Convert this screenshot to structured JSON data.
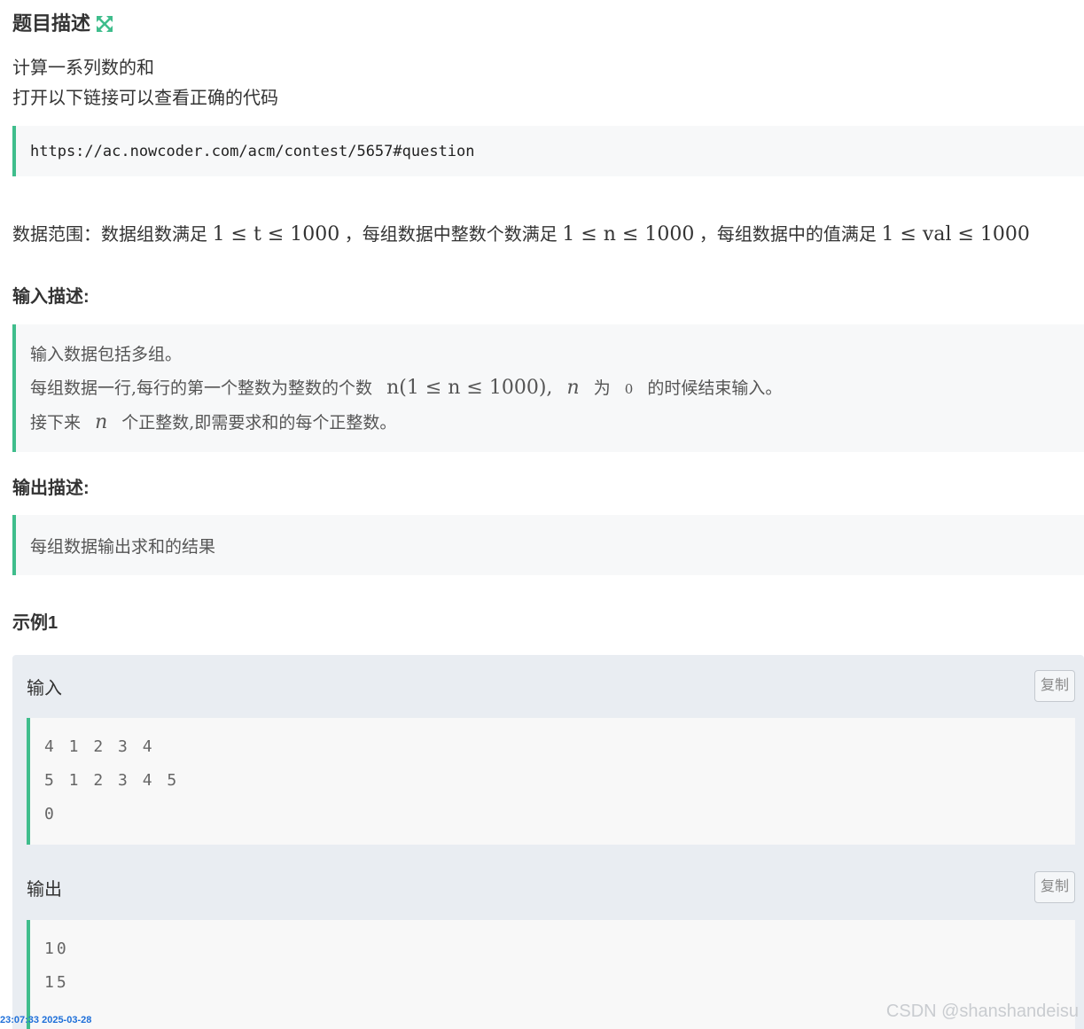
{
  "problem": {
    "title": "题目描述",
    "description_lines": [
      "计算一系列数的和",
      "打开以下链接可以查看正确的代码"
    ],
    "url": "https://ac.nowcoder.com/acm/contest/5657#question",
    "range": {
      "prefix": "数据范围：数据组数满足",
      "t_constraint": "1 ≤ t ≤ 1000",
      "mid1": "，每组数据中整数个数满足",
      "n_constraint": "1 ≤ n ≤ 1000",
      "mid2": "，每组数据中的值满足",
      "val_constraint": "1 ≤ val ≤ 1000"
    }
  },
  "input_desc": {
    "label": "输入描述:",
    "line1": "输入数据包括多组。",
    "line2_prefix": "每组数据一行,每行的第一个整数为整数的个数",
    "line2_math": "n(1 ≤ n ≤ 1000),",
    "line2_n": "n",
    "line2_mid": "为",
    "line2_zero": "0",
    "line2_suffix": "的时候结束输入。",
    "line3_prefix": "接下来",
    "line3_n": "n",
    "line3_suffix": "个正整数,即需要求和的每个正整数。"
  },
  "output_desc": {
    "label": "输出描述:",
    "line1": "每组数据输出求和的结果"
  },
  "example": {
    "label": "示例1",
    "input_label": "输入",
    "output_label": "输出",
    "copy_label": "复制",
    "input_lines": [
      "4 1 2 3 4",
      "5 1 2 3 4 5",
      "0"
    ],
    "output_lines": [
      "10",
      "15"
    ]
  },
  "watermark": "CSDN @shanshandeisu",
  "timestamp": "23:07:33 2025-03-28",
  "colors": {
    "accent": "#3fbd8c",
    "quote_bg": "#f7f8f9",
    "example_bg": "#e9edf2"
  }
}
